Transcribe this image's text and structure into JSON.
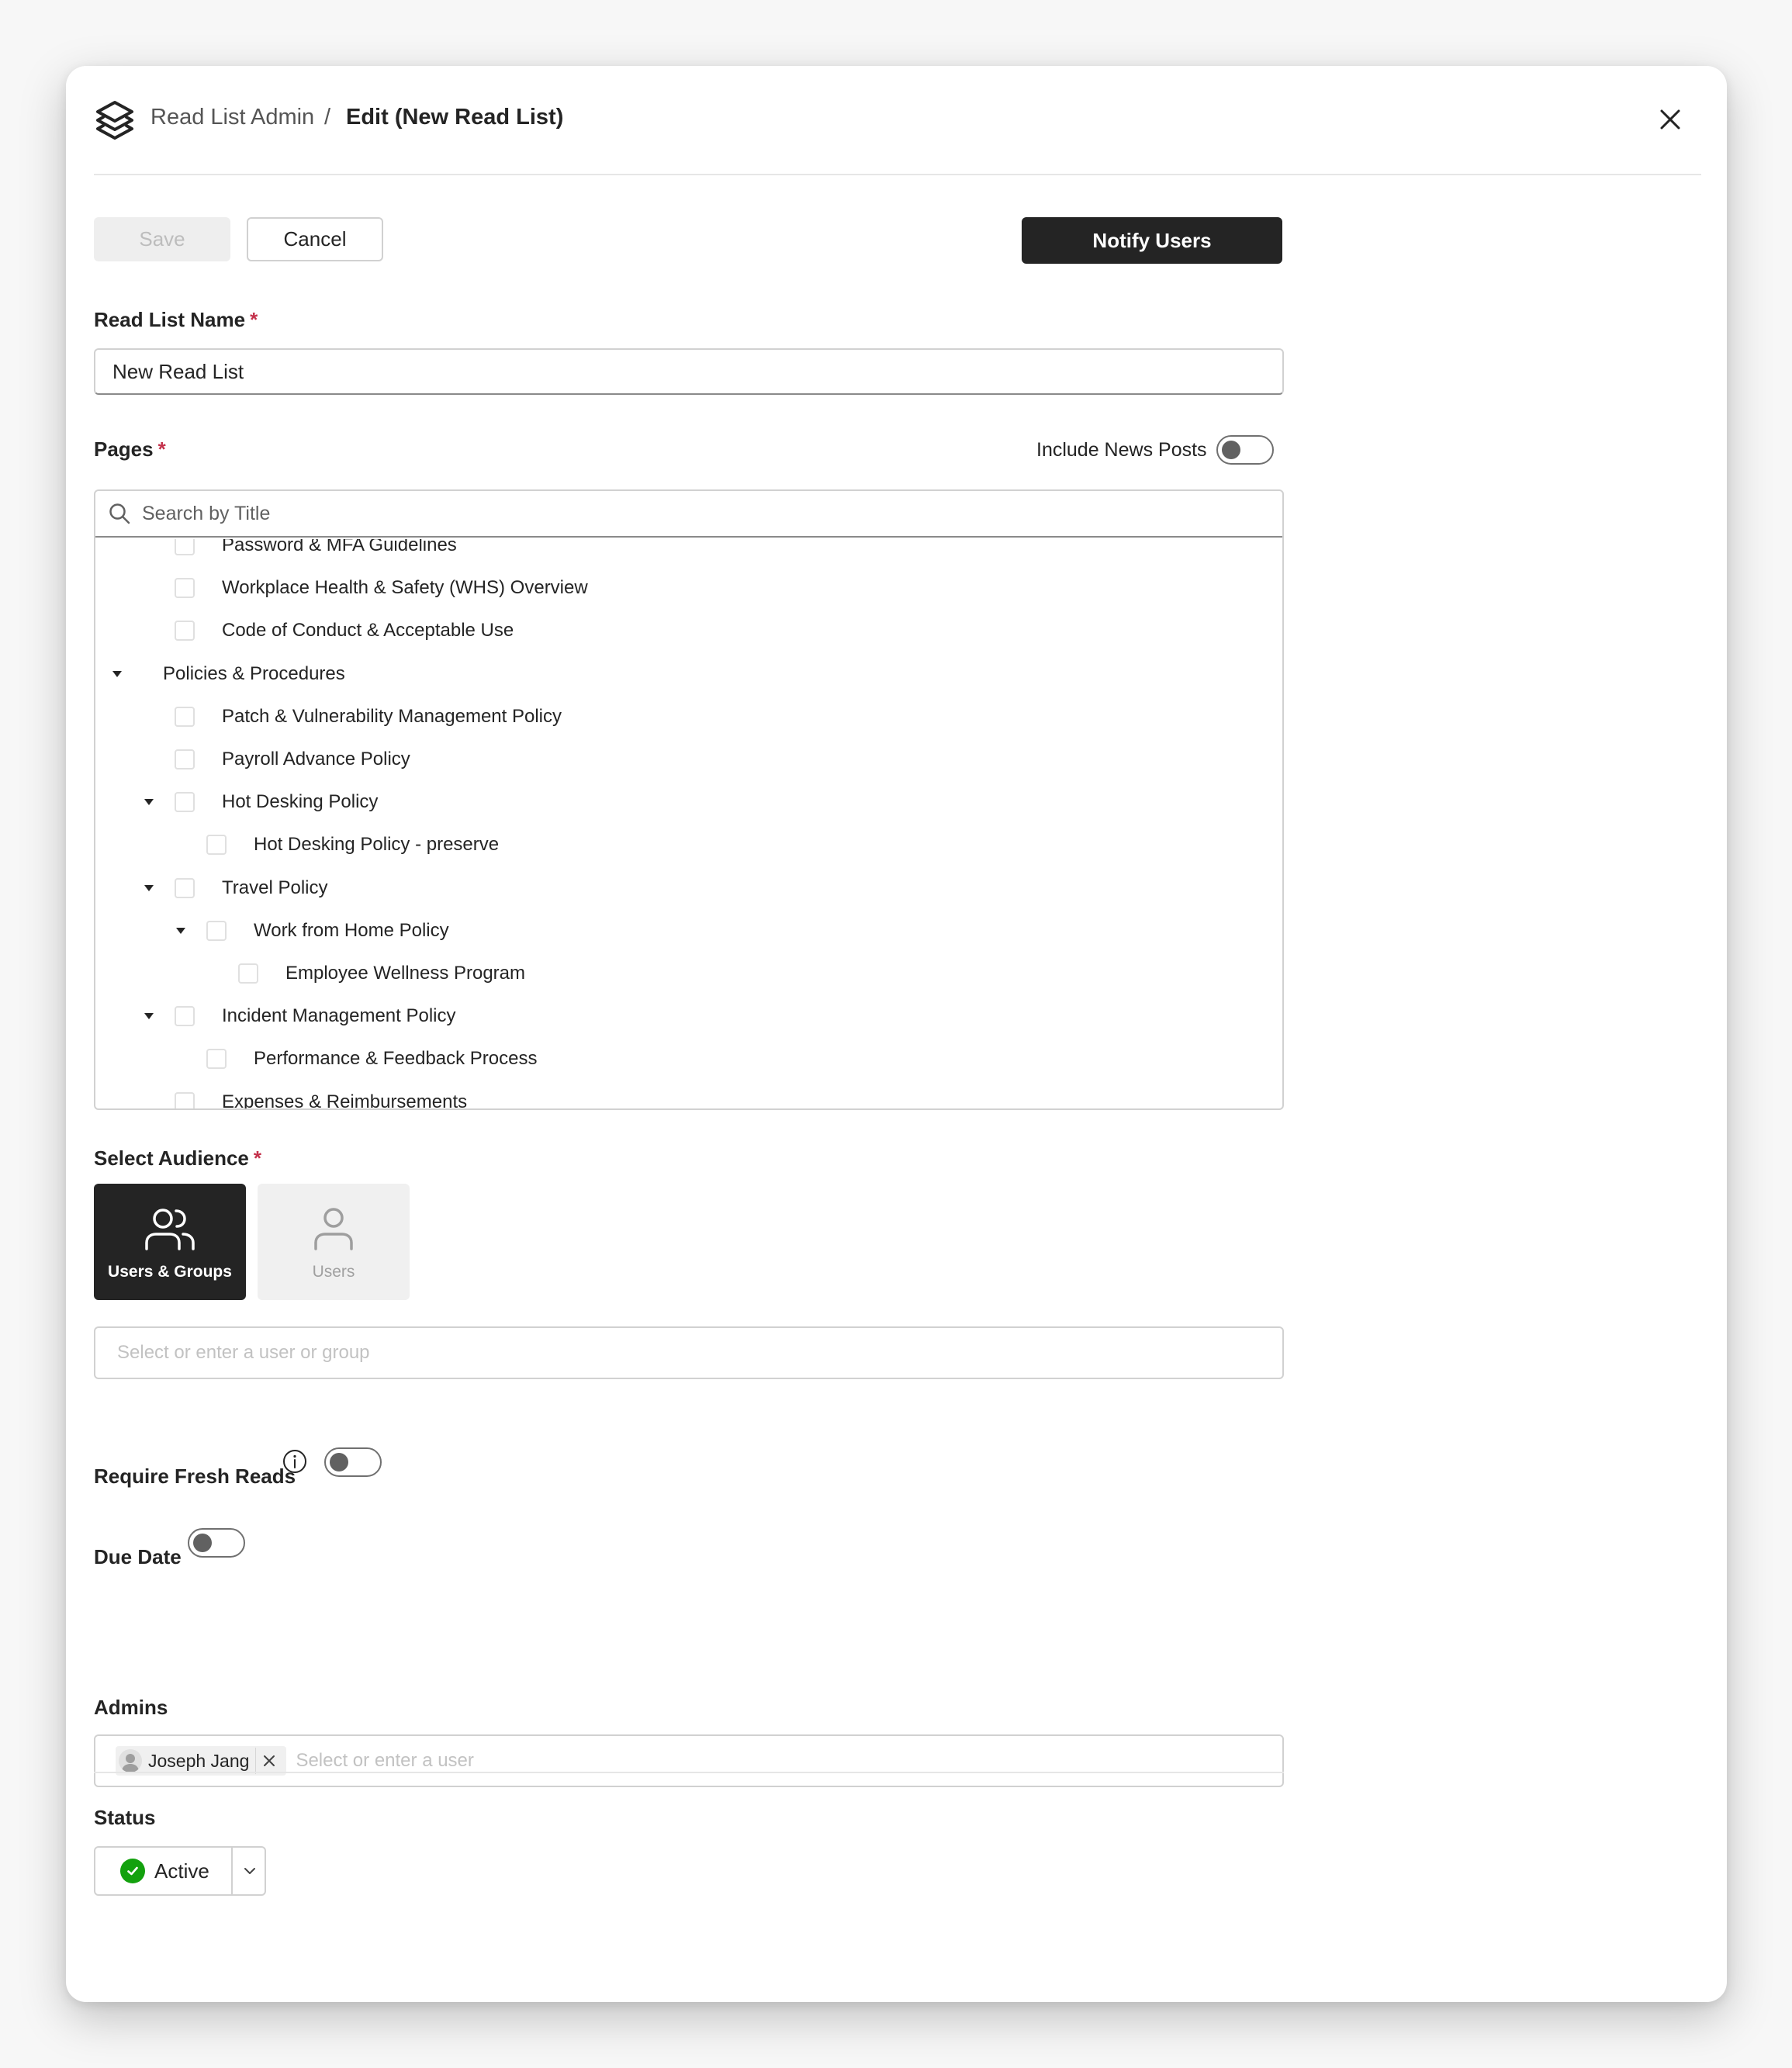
{
  "header": {
    "breadcrumb_root": "Read List Admin",
    "breadcrumb_separator": "/",
    "breadcrumb_current": "Edit (New Read List)",
    "logo_icon": "layers-logo-icon",
    "close_icon": "close-icon"
  },
  "toolbar": {
    "save_label": "Save",
    "cancel_label": "Cancel",
    "notify_label": "Notify Users"
  },
  "read_list_name": {
    "label": "Read List Name",
    "required_mark": "*",
    "value": "New Read List"
  },
  "pages": {
    "label": "Pages",
    "required_mark": "*",
    "include_news_label": "Include News Posts",
    "include_news_on": false,
    "search_placeholder": "Search by Title",
    "tree": [
      {
        "label": "Password & MFA Guidelines",
        "depth": 1,
        "caret": false,
        "checkbox": true,
        "checked": false
      },
      {
        "label": "Workplace Health & Safety (WHS) Overview",
        "depth": 1,
        "caret": false,
        "checkbox": true,
        "checked": false
      },
      {
        "label": "Code of Conduct & Acceptable Use",
        "depth": 1,
        "caret": false,
        "checkbox": true,
        "checked": false
      },
      {
        "label": "Policies & Procedures",
        "depth": 0,
        "caret": true,
        "checkbox": false,
        "checked": false
      },
      {
        "label": "Patch & Vulnerability Management Policy",
        "depth": 1,
        "caret": false,
        "checkbox": true,
        "checked": false
      },
      {
        "label": "Payroll Advance Policy",
        "depth": 1,
        "caret": false,
        "checkbox": true,
        "checked": false
      },
      {
        "label": "Hot Desking Policy",
        "depth": 1,
        "caret": true,
        "checkbox": true,
        "checked": false
      },
      {
        "label": "Hot Desking Policy - preserve",
        "depth": 2,
        "caret": false,
        "checkbox": true,
        "checked": false
      },
      {
        "label": "Travel Policy",
        "depth": 1,
        "caret": true,
        "checkbox": true,
        "checked": false
      },
      {
        "label": "Work from Home Policy",
        "depth": 2,
        "caret": true,
        "checkbox": true,
        "checked": false
      },
      {
        "label": "Employee Wellness Program",
        "depth": 3,
        "caret": false,
        "checkbox": true,
        "checked": false
      },
      {
        "label": "Incident Management Policy",
        "depth": 1,
        "caret": true,
        "checkbox": true,
        "checked": false
      },
      {
        "label": "Performance & Feedback Process",
        "depth": 2,
        "caret": false,
        "checkbox": true,
        "checked": false
      },
      {
        "label": "Expenses & Reimbursements",
        "depth": 1,
        "caret": false,
        "checkbox": true,
        "checked": false
      }
    ]
  },
  "audience": {
    "label": "Select Audience",
    "required_mark": "*",
    "options": [
      {
        "label": "Users & Groups",
        "icon": "users-group-icon",
        "selected": true
      },
      {
        "label": "Users",
        "icon": "user-icon",
        "selected": false
      }
    ],
    "input_placeholder": "Select or enter a user or group"
  },
  "fresh_reads": {
    "label": "Require Fresh Reads",
    "info_icon": "info-icon",
    "on": false
  },
  "due_date": {
    "label": "Due Date",
    "on": false
  },
  "admins": {
    "label": "Admins",
    "chips": [
      {
        "name": "Joseph Jang"
      }
    ],
    "input_placeholder": "Select or enter a user"
  },
  "status": {
    "label": "Status",
    "value": "Active",
    "color": "#13a10e"
  },
  "colors": {
    "primary": "#242424",
    "required": "#c4314b",
    "active_status": "#13a10e"
  }
}
